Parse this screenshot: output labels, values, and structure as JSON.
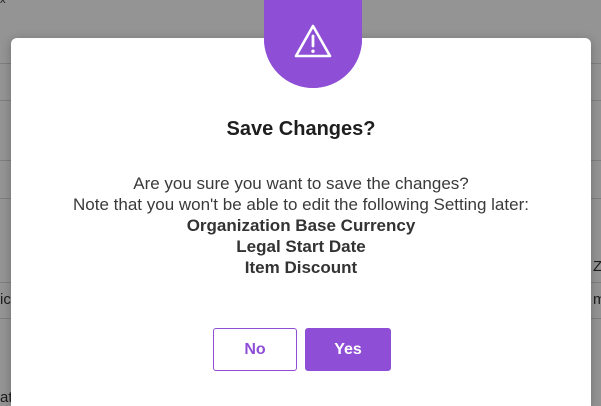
{
  "background": {
    "fragments": [
      "x",
      "ic",
      "at",
      "Z",
      "m"
    ]
  },
  "dialog": {
    "icon": "warning-triangle-icon",
    "title": "Save Changes?",
    "message_line1": "Are you sure you want to save the changes?",
    "message_line2": "Note that you won't be able to edit the following Setting later:",
    "locked_settings": [
      "Organization Base Currency",
      "Legal Start Date",
      "Item Discount"
    ],
    "no_label": "No",
    "yes_label": "Yes"
  },
  "colors": {
    "accent": "#8e4fd6",
    "overlay": "rgba(0,0,0,0.42)"
  }
}
